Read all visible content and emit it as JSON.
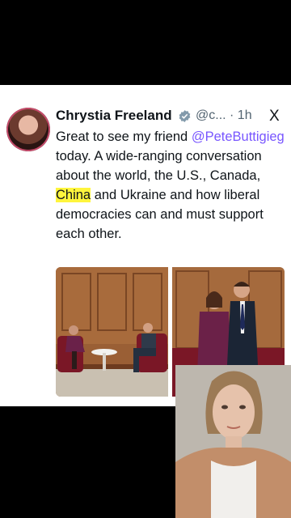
{
  "tweet": {
    "author_name": "Chrystia Freeland",
    "handle_time": "@c... · 1h",
    "close_glyph": "X",
    "text_before": "Great to see my friend ",
    "mention": "@PeteButtigieg",
    "text_middle": " today. A wide-ranging conversation about the world, the U.S., Canada, ",
    "highlighted": "China",
    "text_after": " and Ukraine and how liberal democracies can and must support each other."
  },
  "icons": {
    "verified": "verified-badge-icon",
    "close": "x-logo-icon"
  },
  "colors": {
    "mention": "#7856ff",
    "highlight": "#fff53d",
    "verified": "#829aab"
  }
}
